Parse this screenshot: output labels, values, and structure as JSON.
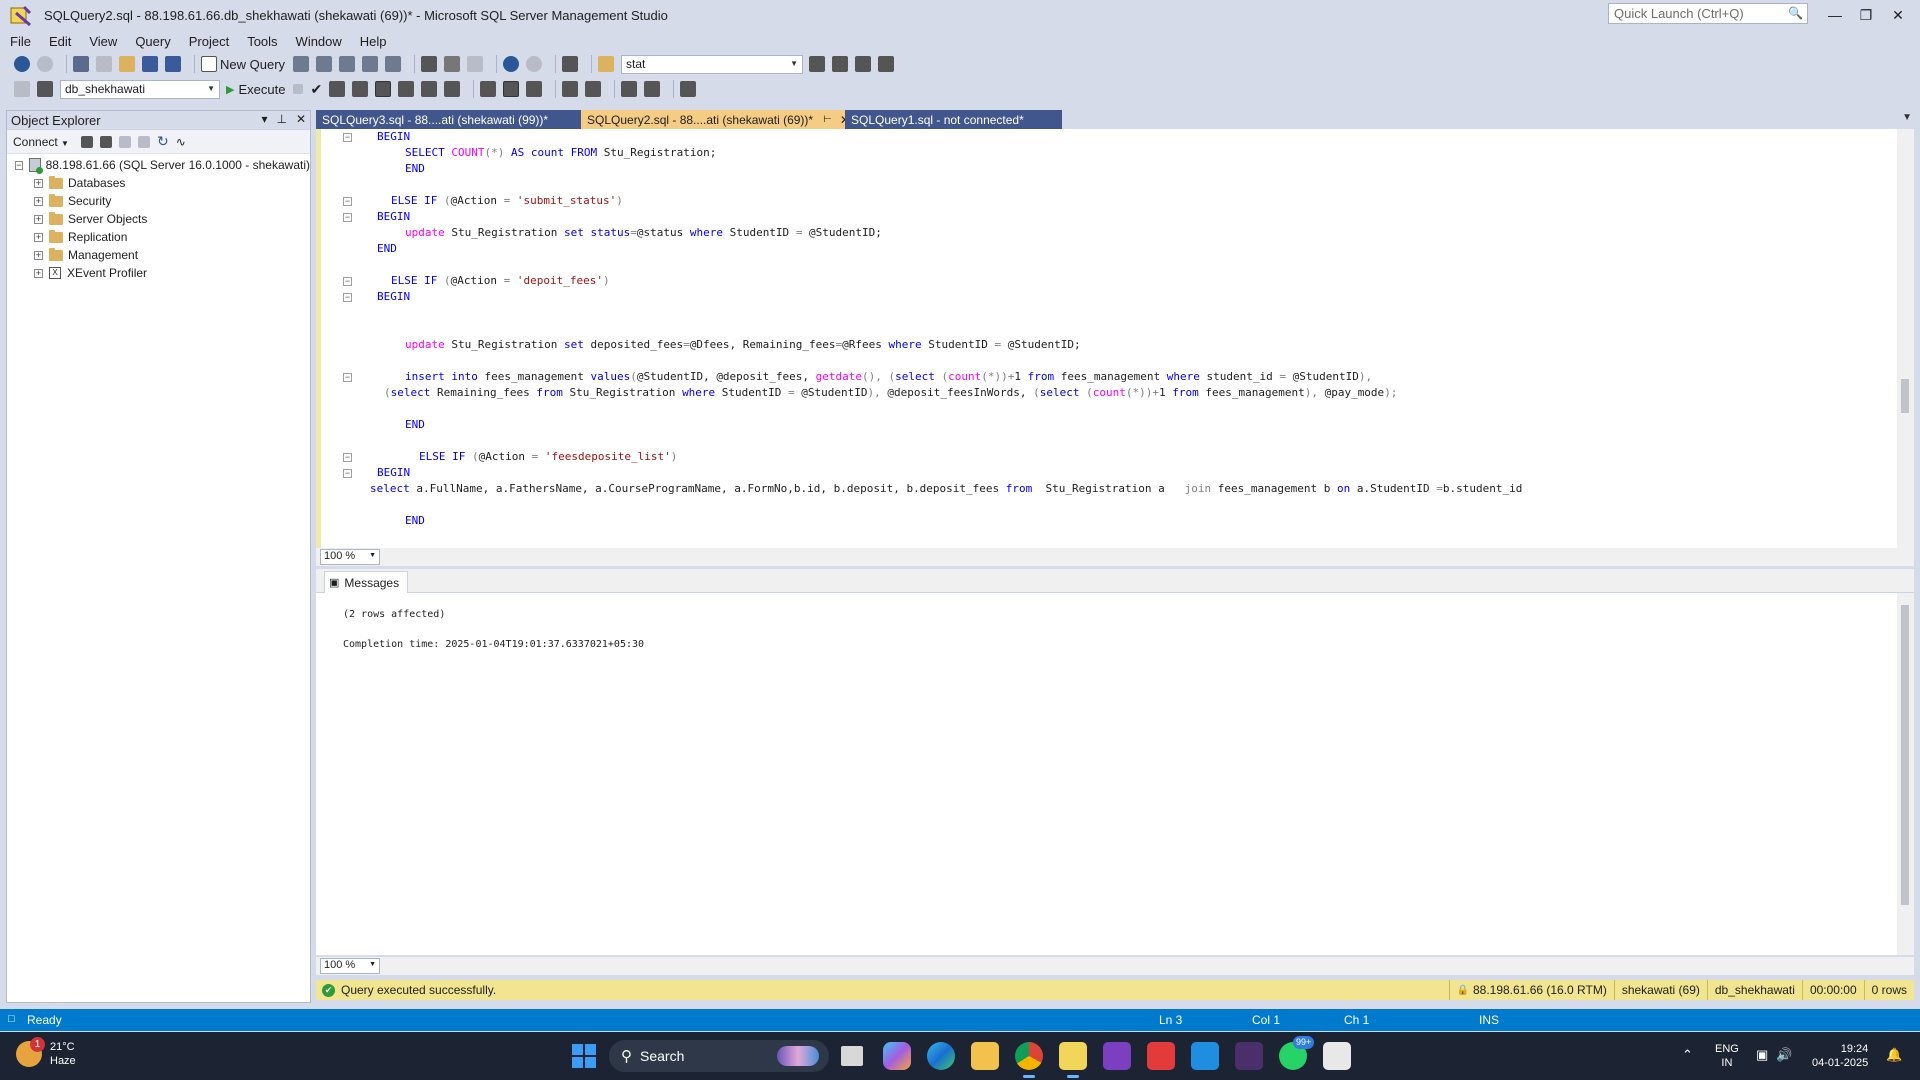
{
  "window": {
    "title": "SQLQuery2.sql - 88.198.61.66.db_shekhawati (shekawati (69))* - Microsoft SQL Server Management Studio",
    "quick_launch_placeholder": "Quick Launch (Ctrl+Q)"
  },
  "menu": [
    "File",
    "Edit",
    "View",
    "Query",
    "Project",
    "Tools",
    "Window",
    "Help"
  ],
  "toolbar": {
    "new_query_label": "New Query",
    "search_combo_value": "stat",
    "database_combo_value": "db_shekhawati",
    "execute_label": "Execute"
  },
  "object_explorer": {
    "title": "Object Explorer",
    "connect_label": "Connect",
    "server_node": "88.198.61.66 (SQL Server 16.0.1000 - shekawati)",
    "nodes": [
      "Databases",
      "Security",
      "Server Objects",
      "Replication",
      "Management",
      "XEvent Profiler"
    ]
  },
  "tabs": [
    {
      "label": "SQLQuery3.sql - 88....ati (shekawati (99))*",
      "active": false
    },
    {
      "label": "SQLQuery2.sql - 88....ati (shekawati (69))*",
      "active": true
    },
    {
      "label": "SQLQuery1.sql - not connected*",
      "active": false
    }
  ],
  "editor": {
    "zoom": "100 %",
    "lines": [
      "BEGIN",
      "SELECT COUNT(*) AS count FROM Stu_Registration;",
      "END",
      "ELSE IF (@Action = 'submit_status')",
      "BEGIN",
      "update Stu_Registration set status=@status where StudentID = @StudentID;",
      "END",
      "ELSE IF (@Action = 'depoit_fees')",
      "BEGIN",
      "update Stu_Registration set deposited_fees=@Dfees, Remaining_fees=@Rfees where StudentID = @StudentID;",
      "insert into fees_management values(@StudentID, @deposit_fees, getdate(), (select (count(*))+1 from fees_management where student_id = @StudentID),",
      "(select Remaining_fees from Stu_Registration where StudentID = @StudentID), @deposit_feesInWords, (select (count(*))+1 from fees_management), @pay_mode);",
      "END",
      "ELSE IF (@Action = 'feesdeposite_list')",
      "BEGIN",
      "select a.FullName, a.FathersName, a.CourseProgramName, a.FormNo,b.id, b.deposit, b.deposit_fees from  Stu_Registration a   join fees_management b on a.StudentID =b.student_id",
      "END"
    ]
  },
  "results": {
    "tab_label": "Messages",
    "zoom": "100 %",
    "messages": [
      "(2 rows affected)",
      "Completion time: 2025-01-04T19:01:37.6337021+05:30"
    ]
  },
  "query_status": {
    "message": "Query executed successfully.",
    "server": "88.198.61.66 (16.0 RTM)",
    "user": "shekawati (69)",
    "database": "db_shekhawati",
    "elapsed": "00:00:00",
    "rows": "0 rows"
  },
  "status_bar": {
    "state": "Ready",
    "line": "Ln 3",
    "col": "Col 1",
    "ch": "Ch 1",
    "mode": "INS"
  },
  "taskbar": {
    "weather_temp": "21°C",
    "weather_cond": "Haze",
    "weather_badge": "1",
    "search_label": "Search",
    "whatsapp_badge": "99+",
    "lang_1": "ENG",
    "lang_2": "IN",
    "time": "19:24",
    "date": "04-01-2025"
  },
  "colors": {
    "title_bg": "#d6dbe9",
    "active_tab": "#f5cc84",
    "inactive_tab": "#40568d",
    "status_bar": "#007acc",
    "query_status_bg": "#f2e58f",
    "keyword": "#0000ff",
    "function": "#ff00ff",
    "string": "#a31515"
  }
}
